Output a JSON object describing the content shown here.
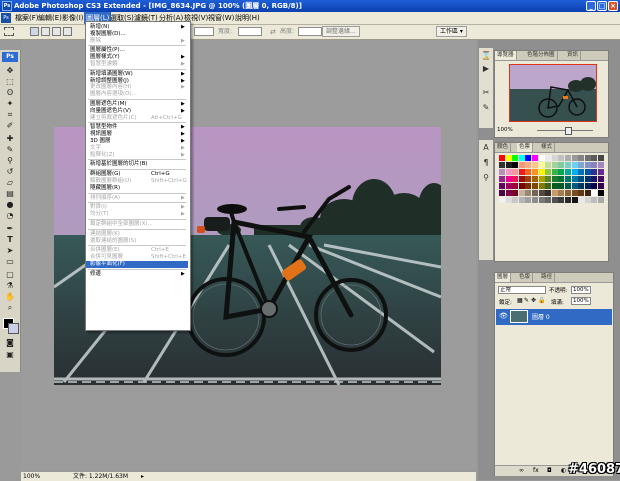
{
  "titlebar": {
    "title": "Adobe Photoshop CS3 Extended - [IMG_8634.JPG @ 100% (圖層 0, RGB/8)]",
    "icon": "Ps"
  },
  "menubar": {
    "items": [
      "檔案(F)",
      "編輯(E)",
      "影像(I)",
      "圖層(L)",
      "選取(S)",
      "濾鏡(T)",
      "分析(A)",
      "檢視(V)",
      "視窗(W)",
      "說明(H)"
    ],
    "active_index": 3
  },
  "optbar": {
    "width_label": "寬度:",
    "height_label": "高度:",
    "refine_label": "調整邊緣...",
    "workspace_label": "工作區 ▾"
  },
  "layer_menu": [
    {
      "label": "新增(N)",
      "shortcut": "",
      "sub": true,
      "disabled": false
    },
    {
      "label": "複製圖層(D)...",
      "shortcut": "",
      "sub": false,
      "disabled": false
    },
    {
      "label": "刪除",
      "shortcut": "",
      "sub": true,
      "disabled": true
    },
    {
      "sep": true
    },
    {
      "label": "圖層屬性(P)...",
      "shortcut": "",
      "sub": false,
      "disabled": false
    },
    {
      "label": "圖層樣式(Y)",
      "shortcut": "",
      "sub": true,
      "disabled": false
    },
    {
      "label": "智慧型濾鏡",
      "shortcut": "",
      "sub": true,
      "disabled": true
    },
    {
      "sep": true
    },
    {
      "label": "新增填滿圖層(W)",
      "shortcut": "",
      "sub": true,
      "disabled": false
    },
    {
      "label": "新增調整圖層(J)",
      "shortcut": "",
      "sub": true,
      "disabled": false
    },
    {
      "label": "更改圖層內容(H)",
      "shortcut": "",
      "sub": true,
      "disabled": true
    },
    {
      "label": "圖層內容選項(O)...",
      "shortcut": "",
      "sub": false,
      "disabled": true
    },
    {
      "sep": true
    },
    {
      "label": "圖層遮色片(M)",
      "shortcut": "",
      "sub": true,
      "disabled": false
    },
    {
      "label": "向量圖遮色片(V)",
      "shortcut": "",
      "sub": true,
      "disabled": false
    },
    {
      "label": "建立剪裁遮色片(C)",
      "shortcut": "Alt+Ctrl+G",
      "sub": false,
      "disabled": true
    },
    {
      "sep": true
    },
    {
      "label": "智慧型物件",
      "shortcut": "",
      "sub": true,
      "disabled": false
    },
    {
      "label": "視訊圖層",
      "shortcut": "",
      "sub": true,
      "disabled": false
    },
    {
      "label": "3D 圖層",
      "shortcut": "",
      "sub": true,
      "disabled": false
    },
    {
      "label": "文字",
      "shortcut": "",
      "sub": true,
      "disabled": true
    },
    {
      "label": "點陣化(Z)",
      "shortcut": "",
      "sub": true,
      "disabled": true
    },
    {
      "sep": true
    },
    {
      "label": "新增基於圖層的切片(B)",
      "shortcut": "",
      "sub": false,
      "disabled": false
    },
    {
      "sep": true
    },
    {
      "label": "群組圖層(G)",
      "shortcut": "Ctrl+G",
      "sub": false,
      "disabled": false
    },
    {
      "label": "解散圖層群組(U)",
      "shortcut": "Shift+Ctrl+G",
      "sub": false,
      "disabled": true
    },
    {
      "label": "隱藏圖層(R)",
      "shortcut": "",
      "sub": false,
      "disabled": false
    },
    {
      "sep": true
    },
    {
      "label": "排列順序(A)",
      "shortcut": "",
      "sub": true,
      "disabled": true
    },
    {
      "sep": true
    },
    {
      "label": "對齊(I)",
      "shortcut": "",
      "sub": true,
      "disabled": true
    },
    {
      "label": "均分(T)",
      "shortcut": "",
      "sub": true,
      "disabled": true
    },
    {
      "sep": true
    },
    {
      "label": "鎖定群組中全部圖層(X)...",
      "shortcut": "",
      "sub": false,
      "disabled": true
    },
    {
      "sep": true
    },
    {
      "label": "連結圖層(K)",
      "shortcut": "",
      "sub": false,
      "disabled": true
    },
    {
      "label": "選取連結的圖層(S)",
      "shortcut": "",
      "sub": false,
      "disabled": true
    },
    {
      "sep": true
    },
    {
      "label": "合併圖層(E)",
      "shortcut": "Ctrl+E",
      "sub": false,
      "disabled": true
    },
    {
      "label": "合併可見圖層",
      "shortcut": "Shift+Ctrl+E",
      "sub": false,
      "disabled": true
    },
    {
      "label": "影像平面化(F)",
      "shortcut": "",
      "sub": false,
      "disabled": false,
      "highlight": true
    },
    {
      "sep": true
    },
    {
      "label": "修邊",
      "shortcut": "",
      "sub": true,
      "disabled": false
    }
  ],
  "statusbar": {
    "zoom": "100%",
    "doc": "文件: 1.22M/1.63M"
  },
  "navigator": {
    "tabs": [
      "導覽器",
      "色階分佈圖",
      "資訊"
    ],
    "zoom": "100%"
  },
  "color_panel": {
    "tabs": [
      "顏色",
      "色票",
      "樣式"
    ]
  },
  "layers_panel": {
    "tabs": [
      "圖層",
      "色版",
      "路徑"
    ],
    "blend_mode": "正常",
    "opacity_label": "不透明:",
    "opacity_value": "100%",
    "lock_label": "鎖定:",
    "fill_label": "填滿:",
    "fill_value": "100%",
    "layer_name": "圖層 0"
  },
  "watermark": "#46087",
  "colors": {
    "menu_highlight": "#316ac5",
    "titlebar": "#0a3fb0"
  }
}
